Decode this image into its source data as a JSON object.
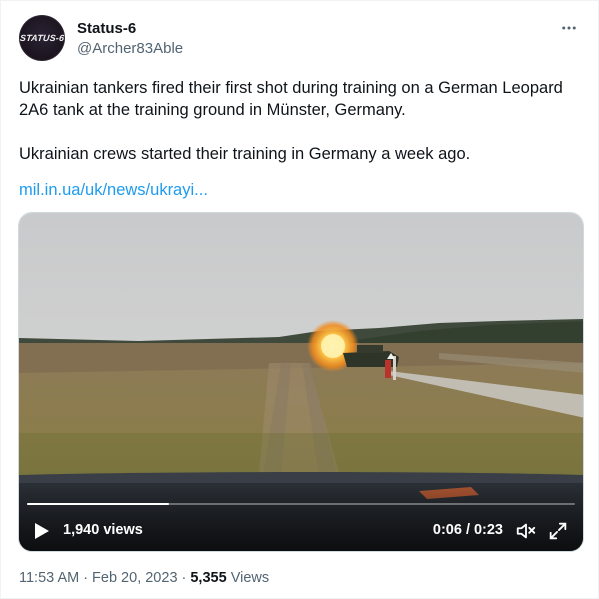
{
  "author": {
    "display_name": "Status-6",
    "handle": "@Archer83Able",
    "avatar_text": "STATUS-6"
  },
  "tweet": {
    "paragraphs": [
      "Ukrainian tankers fired their first shot during training on a German Leopard 2A6 tank at the training ground in Münster, Germany.",
      "Ukrainian crews started their training in Germany a week ago."
    ],
    "link_text": "mil.in.ua/uk/news/ukrayi..."
  },
  "video": {
    "views": "1,940 views",
    "current_time": "0:06",
    "separator": "/",
    "duration": "0:23",
    "progress_fraction": 0.26
  },
  "meta": {
    "time": "11:53 AM",
    "separator": "·",
    "date": "Feb 20, 2023",
    "views_count": "5,355",
    "views_label": "Views"
  },
  "icons": {
    "more": "more-horizontal-icon",
    "play": "play-icon",
    "volume": "volume-muted-icon",
    "fullscreen": "expand-icon"
  },
  "colors": {
    "text": "#0f1419",
    "secondary": "#536471",
    "link": "#1d9bf0",
    "border": "#cfd9de"
  }
}
